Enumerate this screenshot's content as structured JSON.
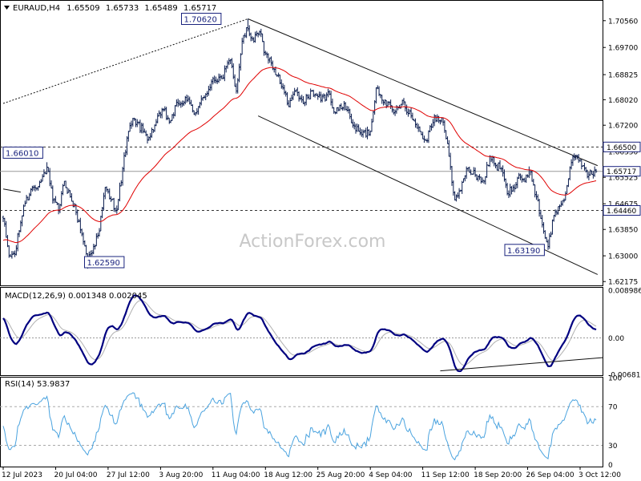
{
  "chart_data": [
    {
      "type": "line",
      "subtype": "candlestick",
      "title": "EURAUD,H4",
      "ohlc_header": [
        "1.65509",
        "1.65733",
        "1.65489",
        "1.65717"
      ],
      "watermark": "ActionForex.com",
      "ylim": [
        1.6205,
        1.712
      ],
      "y_ticks": [
        1.7056,
        1.697,
        1.68825,
        1.6802,
        1.672,
        1.6635,
        1.65525,
        1.64675,
        1.6385,
        1.63,
        1.62175
      ],
      "x_ticks": [
        {
          "label": "12 Jul 2023",
          "bar": 0
        },
        {
          "label": "20 Jul 04:00",
          "bar": 36
        },
        {
          "label": "27 Jul 12:00",
          "bar": 72
        },
        {
          "label": "3 Aug 20:00",
          "bar": 108
        },
        {
          "label": "11 Aug 04:00",
          "bar": 144
        },
        {
          "label": "18 Aug 12:00",
          "bar": 180
        },
        {
          "label": "25 Aug 20:00",
          "bar": 216
        },
        {
          "label": "4 Sep 04:00",
          "bar": 252
        },
        {
          "label": "11 Sep 12:00",
          "bar": 288
        },
        {
          "label": "18 Sep 20:00",
          "bar": 324
        },
        {
          "label": "26 Sep 04:00",
          "bar": 360
        },
        {
          "label": "3 Oct 12:00",
          "bar": 396
        }
      ],
      "n_bars": 408,
      "close_anchors": [
        [
          0,
          1.642
        ],
        [
          4,
          1.63
        ],
        [
          8,
          1.6305
        ],
        [
          14,
          1.646
        ],
        [
          20,
          1.652
        ],
        [
          26,
          1.654
        ],
        [
          30,
          1.6585
        ],
        [
          34,
          1.648
        ],
        [
          38,
          1.6445
        ],
        [
          42,
          1.654
        ],
        [
          46,
          1.649
        ],
        [
          50,
          1.644
        ],
        [
          54,
          1.637
        ],
        [
          58,
          1.629
        ],
        [
          62,
          1.633
        ],
        [
          66,
          1.638
        ],
        [
          70,
          1.652
        ],
        [
          74,
          1.648
        ],
        [
          78,
          1.645
        ],
        [
          82,
          1.658
        ],
        [
          86,
          1.67
        ],
        [
          90,
          1.674
        ],
        [
          96,
          1.67
        ],
        [
          100,
          1.668
        ],
        [
          104,
          1.672
        ],
        [
          110,
          1.677
        ],
        [
          114,
          1.673
        ],
        [
          120,
          1.679
        ],
        [
          126,
          1.68
        ],
        [
          132,
          1.676
        ],
        [
          138,
          1.681
        ],
        [
          144,
          1.687
        ],
        [
          150,
          1.687
        ],
        [
          156,
          1.693
        ],
        [
          160,
          1.683
        ],
        [
          164,
          1.699
        ],
        [
          168,
          1.703
        ],
        [
          172,
          1.699
        ],
        [
          176,
          1.702
        ],
        [
          180,
          1.695
        ],
        [
          184,
          1.692
        ],
        [
          188,
          1.688
        ],
        [
          192,
          1.684
        ],
        [
          196,
          1.678
        ],
        [
          200,
          1.683
        ],
        [
          206,
          1.679
        ],
        [
          212,
          1.683
        ],
        [
          218,
          1.68
        ],
        [
          224,
          1.682
        ],
        [
          228,
          1.676
        ],
        [
          234,
          1.679
        ],
        [
          240,
          1.672
        ],
        [
          246,
          1.669
        ],
        [
          252,
          1.67
        ],
        [
          256,
          1.684
        ],
        [
          262,
          1.68
        ],
        [
          268,
          1.676
        ],
        [
          274,
          1.68
        ],
        [
          280,
          1.675
        ],
        [
          286,
          1.67
        ],
        [
          290,
          1.667
        ],
        [
          296,
          1.675
        ],
        [
          302,
          1.673
        ],
        [
          306,
          1.662
        ],
        [
          310,
          1.648
        ],
        [
          314,
          1.651
        ],
        [
          318,
          1.658
        ],
        [
          324,
          1.656
        ],
        [
          330,
          1.654
        ],
        [
          334,
          1.662
        ],
        [
          338,
          1.659
        ],
        [
          342,
          1.658
        ],
        [
          346,
          1.65
        ],
        [
          350,
          1.652
        ],
        [
          354,
          1.656
        ],
        [
          358,
          1.654
        ],
        [
          362,
          1.657
        ],
        [
          366,
          1.649
        ],
        [
          370,
          1.64
        ],
        [
          374,
          1.633
        ],
        [
          378,
          1.643
        ],
        [
          382,
          1.646
        ],
        [
          386,
          1.65
        ],
        [
          390,
          1.66
        ],
        [
          394,
          1.662
        ],
        [
          398,
          1.659
        ],
        [
          402,
          1.656
        ],
        [
          407,
          1.65717
        ]
      ],
      "highlighted_points": [
        {
          "label": "1.70620",
          "bar": 168,
          "price": 1.7062
        },
        {
          "label": "1.66010",
          "bar": 30,
          "price": 1.6601
        },
        {
          "label": "1.62590",
          "bar": 58,
          "price": 1.6259
        },
        {
          "label": "1.63190",
          "bar": 374,
          "price": 1.6319
        }
      ],
      "horizontal_levels": [
        {
          "label": "1.66500",
          "price": 1.665,
          "style": "dashed"
        },
        {
          "label": "1.64460",
          "price": 1.6446,
          "style": "dashed"
        },
        {
          "label": "1.65717",
          "price": 1.65717,
          "style": "solid"
        }
      ],
      "trendlines": [
        {
          "style": "dotted",
          "from": [
            0,
            1.679
          ],
          "to": [
            168,
            1.7062
          ]
        },
        {
          "style": "solid",
          "from": [
            168,
            1.7062
          ],
          "to": [
            408,
            1.659
          ]
        },
        {
          "style": "solid",
          "from": [
            175,
            1.675
          ],
          "to": [
            408,
            1.624
          ]
        },
        {
          "style": "solid",
          "from": [
            0,
            1.6515
          ],
          "to": [
            12,
            1.6505
          ]
        }
      ],
      "moving_average": {
        "color": "#e00000",
        "period": 55
      }
    },
    {
      "type": "line",
      "title": "MACD(12,26,9) 0.001348 0.002045",
      "ylim": [
        -0.007,
        0.0094
      ],
      "y_ticks": [
        {
          "label": "0.008986",
          "value": 0.008986
        },
        {
          "label": "0.00",
          "value": 0.0
        },
        {
          "label": "-0.006816",
          "value": -0.006816
        }
      ],
      "trendline": {
        "from": [
          300,
          -0.0062
        ],
        "to": [
          408,
          -0.0037
        ]
      }
    },
    {
      "type": "line",
      "title": "RSI(14) 53.9837",
      "ylim": [
        8,
        100
      ],
      "y_ticks": [
        {
          "label": "100",
          "value": 100
        },
        {
          "label": "70",
          "value": 70
        },
        {
          "label": "30",
          "value": 30
        },
        {
          "label": "0",
          "value": 10
        }
      ],
      "levels": [
        70,
        30
      ]
    }
  ],
  "colors": {
    "candles": "#0b1d4f",
    "ma": "#e00000",
    "macd": "#000080",
    "signal": "#b0b0b0",
    "rsi": "#4aa3df",
    "watermark": "#c8c8c8",
    "lines": "#111111"
  },
  "icons": {
    "menu": "triangle-down-icon"
  }
}
